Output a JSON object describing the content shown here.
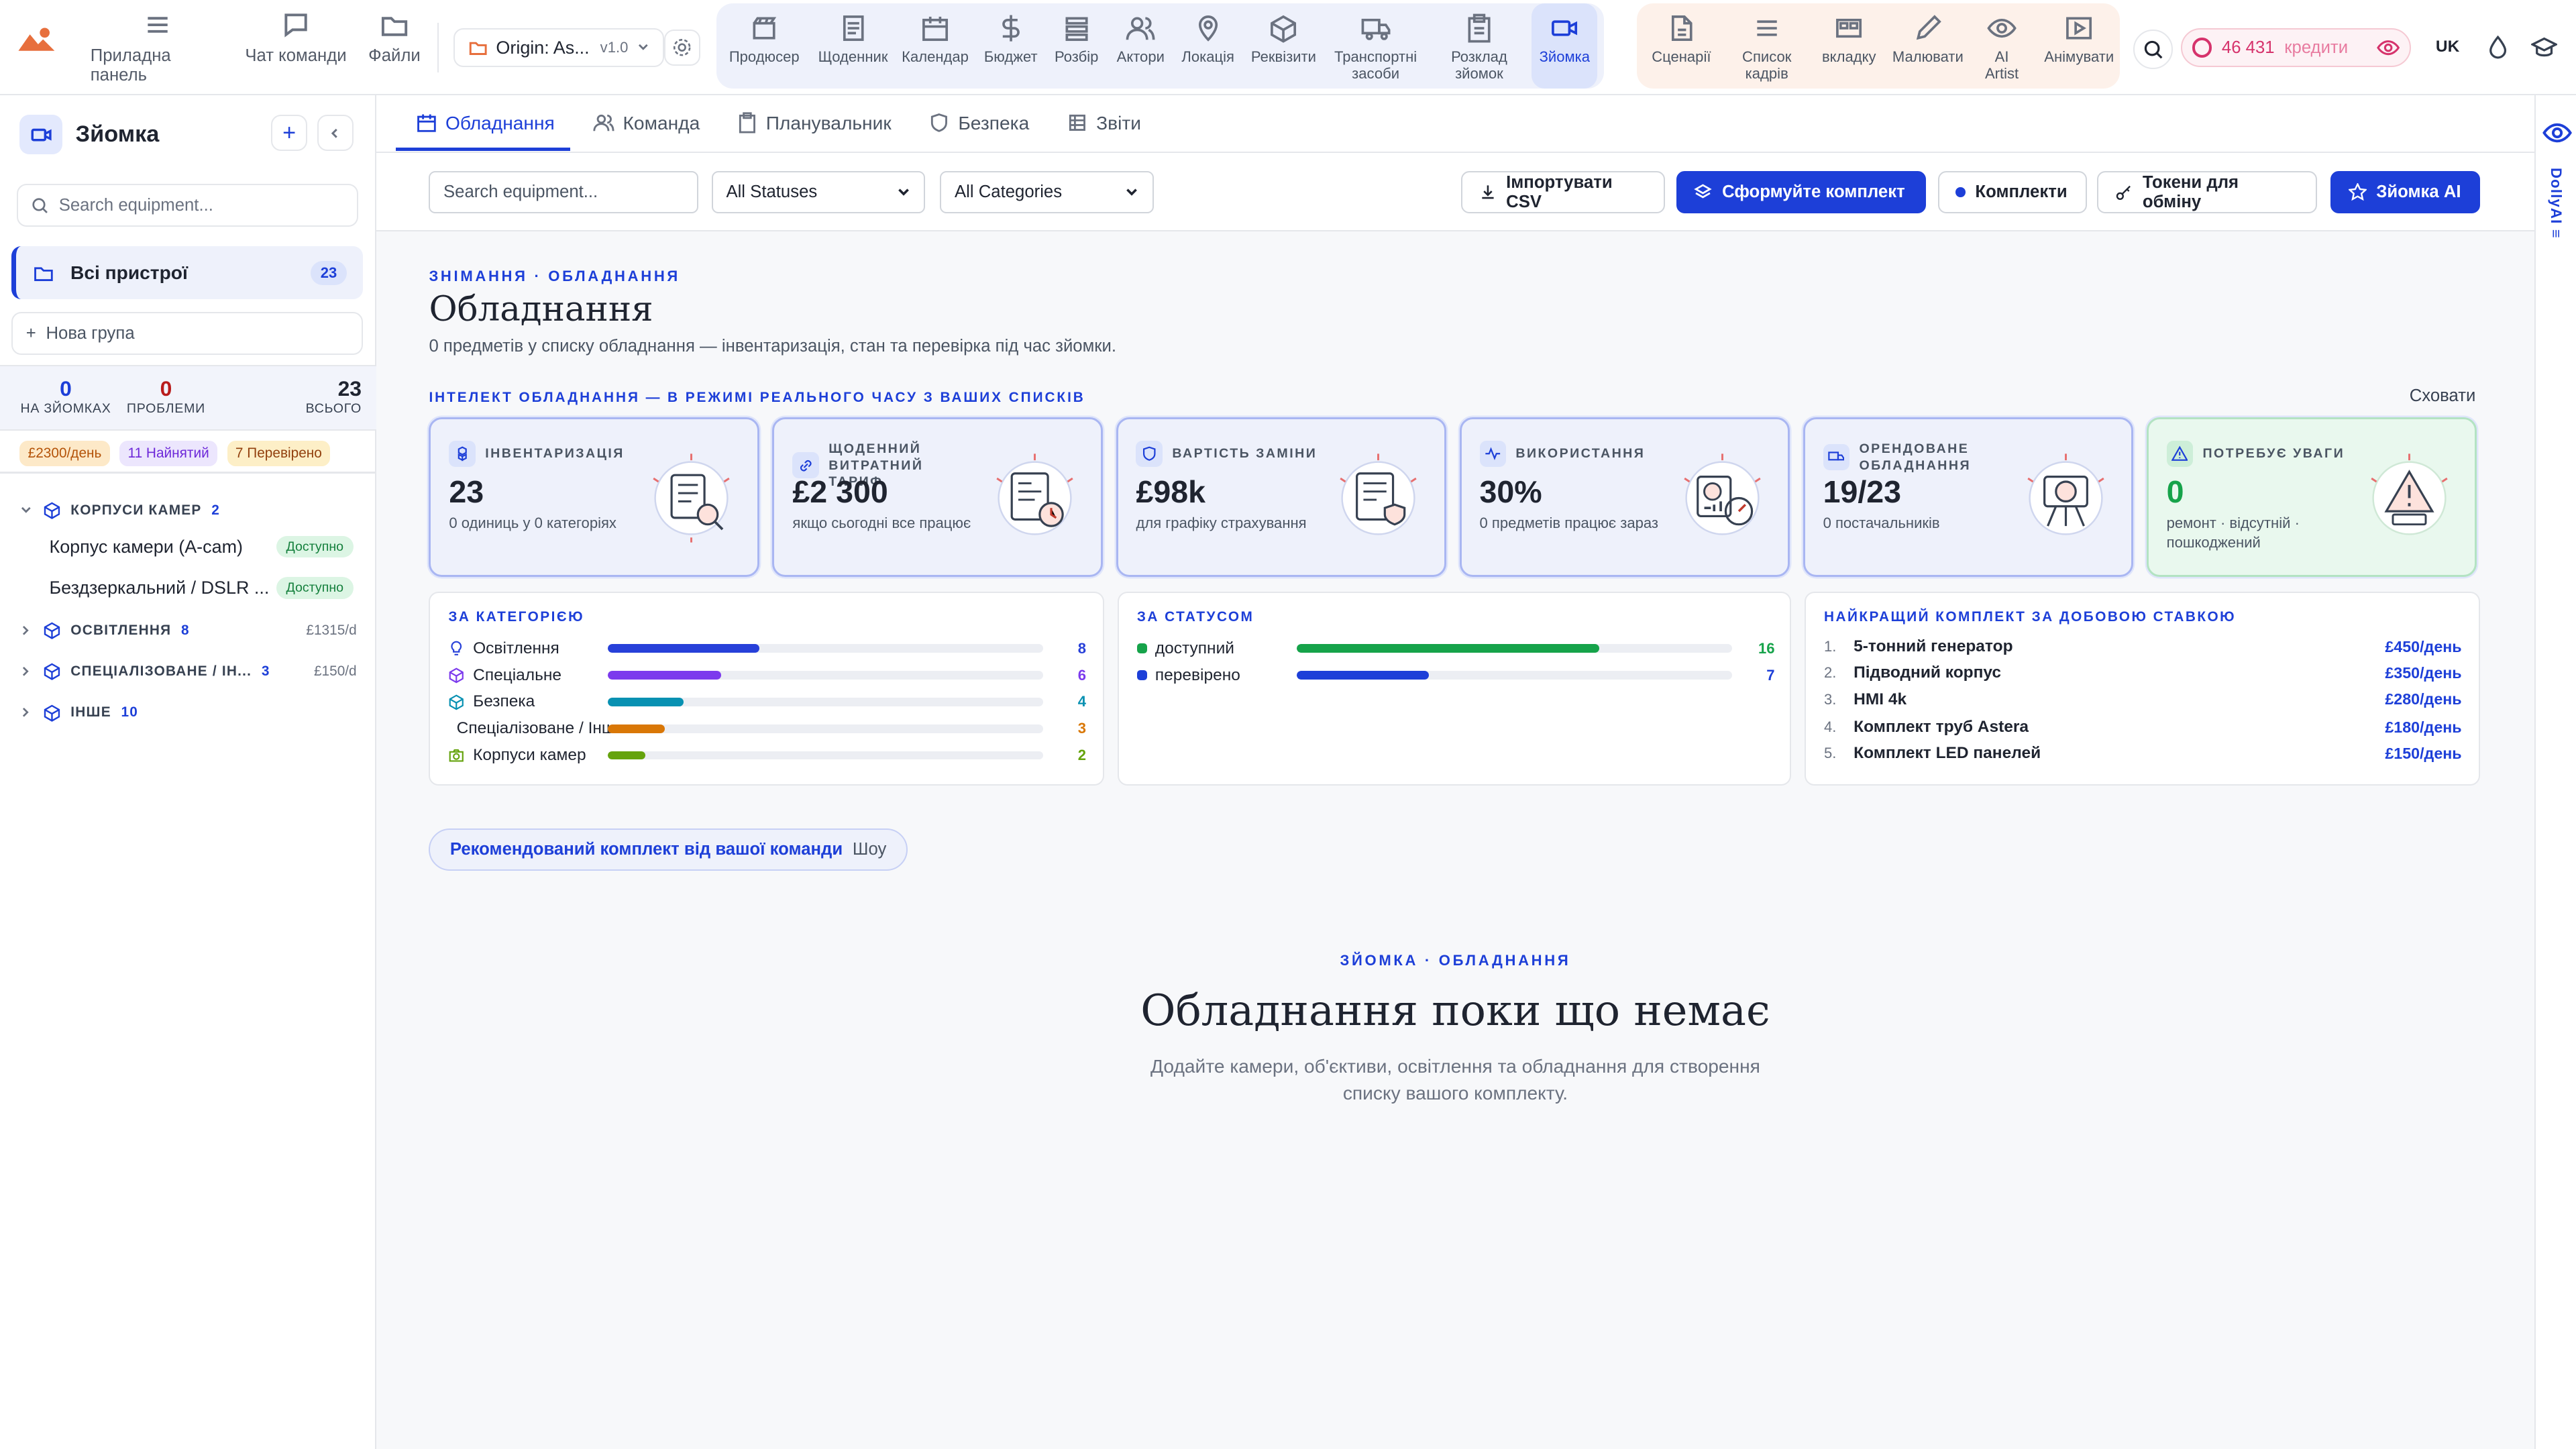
{
  "topbar": {
    "nav": [
      {
        "label": "Приладна панель",
        "icon": "dashboard-icon"
      },
      {
        "label": "Чат команди",
        "icon": "chat-icon"
      },
      {
        "label": "Файли",
        "icon": "folder-icon"
      }
    ],
    "project": {
      "name": "Origin: As...",
      "version": "v1.0"
    },
    "modules": [
      {
        "label": "Продюсер",
        "icon": "clapper-icon"
      },
      {
        "label": "Щоденник",
        "icon": "journal-icon"
      },
      {
        "label": "Календар",
        "icon": "calendar-icon"
      },
      {
        "label": "Бюджет",
        "icon": "dollar-icon"
      },
      {
        "label": "Розбір",
        "icon": "breakdown-icon"
      },
      {
        "label": "Актори",
        "icon": "actors-icon"
      },
      {
        "label": "Локація",
        "icon": "location-icon"
      },
      {
        "label": "Реквізити",
        "icon": "box-icon"
      },
      {
        "label": "Транспортні засоби",
        "icon": "truck-icon"
      },
      {
        "label": "Розклад зйомок",
        "icon": "clipboard-icon"
      },
      {
        "label": "Зйомка",
        "icon": "camera-icon",
        "active": true
      }
    ],
    "tools": [
      {
        "label": "Сценарії",
        "icon": "script-icon"
      },
      {
        "label": "Список кадрів",
        "icon": "list-icon"
      },
      {
        "label": "вкладку",
        "icon": "storyboard-icon"
      },
      {
        "label": "Малювати",
        "icon": "pencil-icon"
      },
      {
        "label": "AI Artist",
        "icon": "eye-icon"
      },
      {
        "label": "Анімувати",
        "icon": "play-icon"
      }
    ],
    "credits": {
      "value": "46 431",
      "label": "кредити"
    },
    "lang": "UK"
  },
  "sidebar": {
    "title": "Зйомка",
    "search_placeholder": "Search equipment...",
    "all_devices": {
      "label": "Всі пристрої",
      "count": "23"
    },
    "new_group": "Нова група",
    "stats": [
      {
        "value": "0",
        "label": "НА ЗЙОМКАХ",
        "color": "#1d3fd8"
      },
      {
        "value": "0",
        "label": "ПРОБЛЕМИ",
        "color": "#b91c1c"
      },
      {
        "value": "23",
        "label": "ВСЬОГО",
        "color": "#1f2430"
      }
    ],
    "badges": [
      {
        "text": "£2300/день",
        "bg": "#fde9c8",
        "fg": "#b45309"
      },
      {
        "text": "11 Найнятий",
        "bg": "#ece6fd",
        "fg": "#6d28d9"
      },
      {
        "text": "7 Перевірено",
        "bg": "#fdefc7",
        "fg": "#92400e"
      }
    ],
    "groups": [
      {
        "name": "КОРПУСИ КАМЕР",
        "count": "2",
        "price": "",
        "expanded": true,
        "items": [
          {
            "name": "Корпус камери (A-cam)",
            "status": "Доступно"
          },
          {
            "name": "Бездзеркальний / DSLR ...",
            "status": "Доступно"
          }
        ]
      },
      {
        "name": "ОСВІТЛЕННЯ",
        "count": "8",
        "price": "£1315/d"
      },
      {
        "name": "СПЕЦІАЛІЗОВАНЕ / ІН...",
        "count": "3",
        "price": "£150/d"
      },
      {
        "name": "ІНШЕ",
        "count": "10",
        "price": ""
      }
    ]
  },
  "tabs": [
    {
      "label": "Обладнання",
      "icon": "calendar-icon",
      "active": true
    },
    {
      "label": "Команда",
      "icon": "users-icon"
    },
    {
      "label": "Планувальник",
      "icon": "clipboard-icon"
    },
    {
      "label": "Безпека",
      "icon": "shield-icon"
    },
    {
      "label": "Звіти",
      "icon": "grid-icon"
    }
  ],
  "filters": {
    "search_placeholder": "Search equipment...",
    "status": "All Statuses",
    "category": "All Categories",
    "import_csv": "Імпортувати CSV",
    "build_kit": "Сформуйте комплект",
    "kits": "Комплекти",
    "tokens": "Токени для обміну",
    "ai": "Зйомка AI"
  },
  "content": {
    "eyebrow": "ЗНІМАННЯ · ОБЛАДНАННЯ",
    "title": "Обладнання",
    "subtitle": "0 предметів у списку обладнання — інвентаризація, стан та перевірка під час зйомки.",
    "intel_label": "ІНТЕЛЕКТ ОБЛАДНАННЯ — В РЕЖИМІ РЕАЛЬНОГО ЧАСУ З ВАШИХ СПИСКІВ",
    "hide": "Сховати"
  },
  "cards": [
    {
      "title": "ІНВЕНТАРИЗАЦІЯ",
      "value": "23",
      "note": "0 одиниць у 0 категоріях",
      "icon": "cube-group-icon"
    },
    {
      "title": "ЩОДЕННИЙ ВИТРАТНИЙ ТАРИФ",
      "value": "£2 300",
      "note": "якщо сьогодні все працює",
      "icon": "link-icon"
    },
    {
      "title": "ВАРТІСТЬ ЗАМІНИ",
      "value": "£98k",
      "note": "для графіку страхування",
      "icon": "shield-icon"
    },
    {
      "title": "ВИКОРИСТАННЯ",
      "value": "30%",
      "note": "0 предметів працює зараз",
      "icon": "pulse-icon"
    },
    {
      "title": "ОРЕНДОВАНЕ ОБЛАДНАННЯ",
      "value": "19/23",
      "note": "0 постачальників",
      "icon": "truck-icon"
    },
    {
      "title": "ПОТРЕБУЄ УВАГИ",
      "value": "0",
      "note": "ремонт · відсутній · пошкоджений",
      "icon": "warning-icon",
      "green": true
    }
  ],
  "by_category": {
    "title": "ЗА КАТЕГОРІЄЮ",
    "rows": [
      {
        "label": "Освітлення",
        "value": 8,
        "color": "#2740d9",
        "icon": "bulb-icon"
      },
      {
        "label": "Спеціальне",
        "value": 6,
        "color": "#7c3aed",
        "icon": "cube-icon"
      },
      {
        "label": "Безпека",
        "value": 4,
        "color": "#0891b2",
        "icon": "cube-icon"
      },
      {
        "label": "Спеціалізоване / Інше",
        "value": 3,
        "color": "#d97706",
        "icon": "cube-icon"
      },
      {
        "label": "Корпуси камер",
        "value": 2,
        "color": "#65a30d",
        "icon": "camera-icon"
      }
    ],
    "max": 23
  },
  "by_status": {
    "title": "ЗА СТАТУСОМ",
    "rows": [
      {
        "label": "доступний",
        "value": 16,
        "color": "#16a34a"
      },
      {
        "label": "перевірено",
        "value": 7,
        "color": "#1d3fd8"
      }
    ],
    "max": 23
  },
  "top_kit": {
    "title": "НАЙКРАЩИЙ КОМПЛЕКТ ЗА ДОБОВОЮ СТАВКОЮ",
    "rows": [
      {
        "num": "1.",
        "name": "5-тонний генератор",
        "rate": "£450/день"
      },
      {
        "num": "2.",
        "name": "Підводний корпус",
        "rate": "£350/день"
      },
      {
        "num": "3.",
        "name": "HMI 4k",
        "rate": "£280/день"
      },
      {
        "num": "4.",
        "name": "Комплект труб Astera",
        "rate": "£180/день"
      },
      {
        "num": "5.",
        "name": "Комплект LED панелей",
        "rate": "£150/день"
      }
    ]
  },
  "recommended": {
    "label": "Рекомендований комплект від вашої команди",
    "action": "Шоу"
  },
  "empty": {
    "eyebrow": "ЗЙОМКА · ОБЛАДНАННЯ",
    "title": "Обладнання поки що немає",
    "desc1": "Додайте камери, об'єктиви, освітлення та обладнання для створення",
    "desc2": "списку вашого комплекту."
  },
  "right_strip": {
    "label": "DollyAI ≡"
  }
}
